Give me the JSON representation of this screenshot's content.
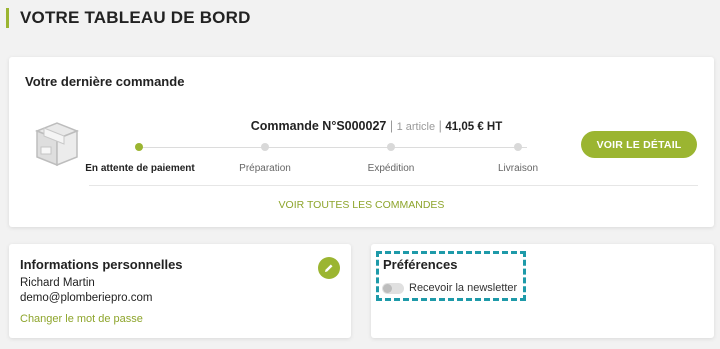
{
  "page": {
    "title": "VOTRE TABLEAU DE BORD"
  },
  "last_order": {
    "heading": "Votre dernière commande",
    "number": "Commande N°S000027",
    "separator": "|",
    "articles": "1 article",
    "price": "41,05 € HT",
    "steps": [
      {
        "label": "En attente de paiement",
        "active": true
      },
      {
        "label": "Préparation",
        "active": false
      },
      {
        "label": "Expédition",
        "active": false
      },
      {
        "label": "Livraison",
        "active": false
      }
    ],
    "detail_button": "VOIR LE DÉTAIL",
    "all_orders_link": "VOIR TOUTES LES COMMANDES"
  },
  "personal_info": {
    "heading": "Informations personnelles",
    "name": "Richard Martin",
    "email": "demo@plomberiepro.com",
    "change_password": "Changer le mot de passe"
  },
  "preferences": {
    "heading": "Préférences",
    "newsletter_label": "Recevoir la newsletter",
    "newsletter_enabled": false
  },
  "colors": {
    "accent": "#9bb531",
    "highlight": "#1e9aa9"
  },
  "icons": [
    "package-box-icon",
    "pencil-edit-icon"
  ]
}
